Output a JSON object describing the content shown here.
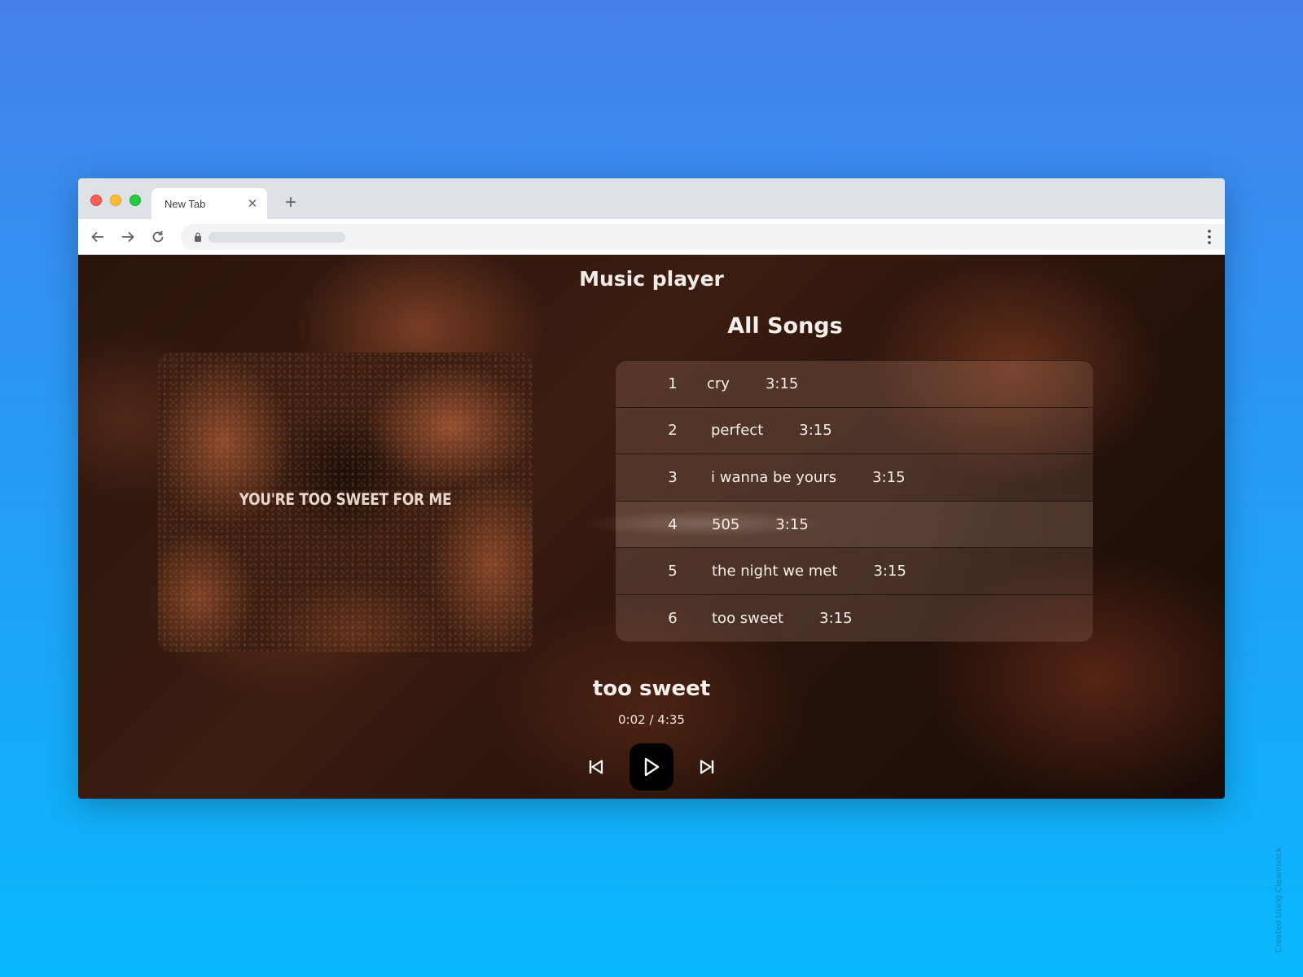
{
  "browser": {
    "tab_title": "New Tab",
    "tab_close": "✕",
    "new_tab": "+"
  },
  "app": {
    "title": "Music player",
    "list_heading": "All Songs",
    "album_art_text": "YOU'RE TOO SWEET FOR ME"
  },
  "songs": [
    {
      "num": "1",
      "name": "cry",
      "duration": "3:15"
    },
    {
      "num": "2",
      "name": "perfect",
      "duration": "3:15"
    },
    {
      "num": "3",
      "name": "i wanna be yours",
      "duration": "3:15"
    },
    {
      "num": "4",
      "name": "505",
      "duration": "3:15"
    },
    {
      "num": "5",
      "name": "the night we met",
      "duration": "3:15"
    },
    {
      "num": "6",
      "name": "too sweet",
      "duration": "3:15"
    }
  ],
  "now_playing": {
    "title": "too sweet",
    "time": "0:02 / 4:35"
  },
  "controls": {
    "previous_icon": "skip-previous-icon",
    "play_icon": "play-icon",
    "next_icon": "skip-next-icon"
  },
  "watermark": "Created Using Cleanmock"
}
